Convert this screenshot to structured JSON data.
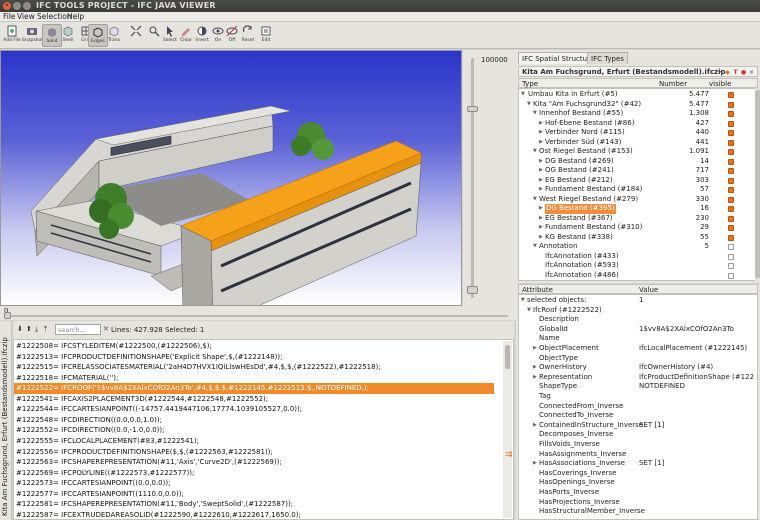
{
  "window": {
    "title": "IFC TOOLS PROJECT - IFC JAVA VIEWER"
  },
  "menu": [
    "File",
    "View",
    "Selection",
    "Help"
  ],
  "toolbar": [
    "Add File",
    "Snapshot",
    "Solid",
    "Shell",
    "Grid",
    "Edges",
    "Trans",
    "",
    "",
    "Select",
    "Clear",
    "Invert",
    "On",
    "Off",
    "Reset",
    "Edit"
  ],
  "slider": {
    "vmax": "100000",
    "hmin": "0"
  },
  "tabs": [
    "IFC Spatial Structure",
    "IFC Types"
  ],
  "spatial": {
    "file": "Kita Am Fuchsgrund, Erfurt (Bestandsmodell).ifczip",
    "columns": [
      "Type",
      "Number",
      "visible"
    ],
    "rows": [
      {
        "name": "Umbau Kita in Erfurt (#5)",
        "num": "5.477"
      },
      {
        "name": "Kita \"Am Fuchsgrund32\" (#42)",
        "num": "5.477"
      },
      {
        "name": "Innenhof Bestand (#55)",
        "num": "1.308"
      },
      {
        "name": "Hof-Ebene Bestand (#86)",
        "num": "427"
      },
      {
        "name": "Verbinder Nord (#115)",
        "num": "440"
      },
      {
        "name": "Verbinder Süd (#143)",
        "num": "441"
      },
      {
        "name": "Ost Riegel Bestand (#153)",
        "num": "1.091"
      },
      {
        "name": "DG Bestand (#269)",
        "num": "14"
      },
      {
        "name": "OG Bestand (#241)",
        "num": "717"
      },
      {
        "name": "EG Bestand (#212)",
        "num": "303"
      },
      {
        "name": "Fundament Bestand (#184)",
        "num": "57"
      },
      {
        "name": "West Riegel Bestand (#279)",
        "num": "330"
      },
      {
        "name": "DG Bestand (#395)",
        "num": "16"
      },
      {
        "name": "EG Bestand (#367)",
        "num": "230"
      },
      {
        "name": "Fundament Bestand (#310)",
        "num": "29"
      },
      {
        "name": "KG Bestand (#338)",
        "num": "55"
      },
      {
        "name": "Annotation",
        "num": "5"
      },
      {
        "name": "IfcAnnotation (#433)",
        "num": ""
      },
      {
        "name": "IfcAnnotation (#593)",
        "num": ""
      },
      {
        "name": "IfcAnnotation (#486)",
        "num": ""
      }
    ]
  },
  "attributes": {
    "columns": [
      "Attribute",
      "Value"
    ],
    "rows": [
      {
        "name": "selected objects:",
        "value": "1",
        "arrow": "▼",
        "indent": 0
      },
      {
        "name": "IfcRoof (#1222522)",
        "value": "",
        "arrow": "▼",
        "indent": 1
      },
      {
        "name": "Description",
        "value": "",
        "arrow": "",
        "indent": 2
      },
      {
        "name": "GlobalId",
        "value": "1$vv8A$2XAlxCOfO2An3To",
        "arrow": "",
        "indent": 2
      },
      {
        "name": "Name",
        "value": "",
        "arrow": "",
        "indent": 2
      },
      {
        "name": "ObjectPlacement",
        "value": "IfcLocalPlacement (#1222145)",
        "arrow": "▶",
        "indent": 2
      },
      {
        "name": "ObjectType",
        "value": "",
        "arrow": "",
        "indent": 2
      },
      {
        "name": "OwnerHistory",
        "value": "IfcOwnerHistory (#4)",
        "arrow": "▶",
        "indent": 2
      },
      {
        "name": "Representation",
        "value": "IfcProductDefinitionShape (#122",
        "arrow": "▶",
        "indent": 2
      },
      {
        "name": "ShapeType",
        "value": "NOTDEFINED",
        "arrow": "",
        "indent": 2
      },
      {
        "name": "Tag",
        "value": "",
        "arrow": "",
        "indent": 2
      },
      {
        "name": "ConnectedFrom_Inverse",
        "value": "",
        "arrow": "",
        "indent": 2
      },
      {
        "name": "ConnectedTo_Inverse",
        "value": "",
        "arrow": "",
        "indent": 2
      },
      {
        "name": "ContainedInStructure_Inverse",
        "value": "SET [1]",
        "arrow": "▶",
        "indent": 2
      },
      {
        "name": "Decomposes_Inverse",
        "value": "",
        "arrow": "",
        "indent": 2
      },
      {
        "name": "FillsVoids_Inverse",
        "value": "",
        "arrow": "",
        "indent": 2
      },
      {
        "name": "HasAssignments_Inverse",
        "value": "",
        "arrow": "",
        "indent": 2
      },
      {
        "name": "HasAssociations_Inverse",
        "value": "SET [1]",
        "arrow": "▶",
        "indent": 2
      },
      {
        "name": "HasCoverings_Inverse",
        "value": "",
        "arrow": "",
        "indent": 2
      },
      {
        "name": "HasOpenings_Inverse",
        "value": "",
        "arrow": "",
        "indent": 2
      },
      {
        "name": "HasPorts_Inverse",
        "value": "",
        "arrow": "",
        "indent": 2
      },
      {
        "name": "HasProjections_Inverse",
        "value": "",
        "arrow": "",
        "indent": 2
      },
      {
        "name": "HasStructuralMember_Inverse",
        "value": "",
        "arrow": "",
        "indent": 2
      }
    ]
  },
  "textview": {
    "tab": "Kita Am Fuchsgrund, Erfurt (Bestandsmodell).ifczip",
    "search_placeholder": "search...",
    "info": "Lines: 427.928   Selected: 1",
    "lines": [
      {
        "text": "#1222508= IFCSTYLEDITEM(#1222500,(#1222506),$);",
        "hl": false
      },
      {
        "text": "#1222513= IFCPRODUCTDEFINITIONSHAPE('Explicit Shape',$,(#1222148));",
        "hl": false
      },
      {
        "text": "#1222515= IFCRELASSOCIATESMATERIAL('2aH4D7HVX1IQiLlswHEsDd',#4,$,$,(#1222522),#1222518);",
        "hl": false
      },
      {
        "text": "#1222518= IFCMATERIAL('');",
        "hl": false
      },
      {
        "text": "#1222522= IFCROOF('1$vv8A$2XAlxCOfO2An3To',#4,$,$,$,#1222145,#1222513,$,.NOTDEFINED.);",
        "hl": true
      },
      {
        "text": "#1222541= IFCAXIS2PLACEMENT3D(#1222544,#1222548,#1222552);",
        "hl": false
      },
      {
        "text": "#1222544= IFCCARTESIANPOINT((-14757.4419447106,17774.1039105527,0.0));",
        "hl": false
      },
      {
        "text": "#1222548= IFCDIRECTION((0.0,0.0,1.0));",
        "hl": false
      },
      {
        "text": "#1222552= IFCDIRECTION((0.0,-1.0,0.0));",
        "hl": false
      },
      {
        "text": "#1222555= IFCLOCALPLACEMENT(#83,#1222541);",
        "hl": false
      },
      {
        "text": "#1222556= IFCPRODUCTDEFINITIONSHAPE($,$,(#1222563,#1222581));",
        "hl": false
      },
      {
        "text": "#1222563= IFCSHAPEREPRESENTATION(#11,'Axis','Curve2D',(#1222569));",
        "hl": false
      },
      {
        "text": "#1222569= IFCPOLYLINE((#1222573,#1222577));",
        "hl": false
      },
      {
        "text": "#1222573= IFCCARTESIANPOINT((0.0,0.0));",
        "hl": false
      },
      {
        "text": "#1222577= IFCCARTESIANPOINT((1110.0,0.0));",
        "hl": false
      },
      {
        "text": "#1222581= IFCSHAPEREPRESENTATION(#11,'Body','SweptSolid',(#1222587));",
        "hl": false
      },
      {
        "text": "#1222587= IFCEXTRUDEDAREASOLID(#1222590,#1222610,#1222617,1650.0);",
        "hl": false
      }
    ]
  }
}
